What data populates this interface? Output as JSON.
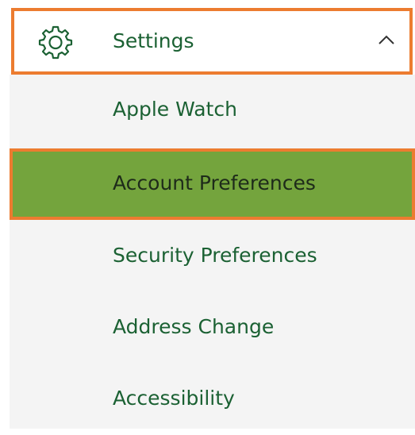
{
  "settings_menu": {
    "header": {
      "icon": "gear-icon",
      "label": "Settings",
      "expanded": true,
      "chevron": "chevron-up-icon"
    },
    "items": [
      {
        "label": "Apple Watch",
        "active": false
      },
      {
        "label": "Account Preferences",
        "active": true
      },
      {
        "label": "Security Preferences",
        "active": false
      },
      {
        "label": "Address Change",
        "active": false
      },
      {
        "label": "Accessibility",
        "active": false
      }
    ]
  },
  "colors": {
    "text_green": "#1b6133",
    "active_bg": "#74a43d",
    "highlight_border": "#ec7c30",
    "submenu_bg": "#f4f4f4"
  }
}
